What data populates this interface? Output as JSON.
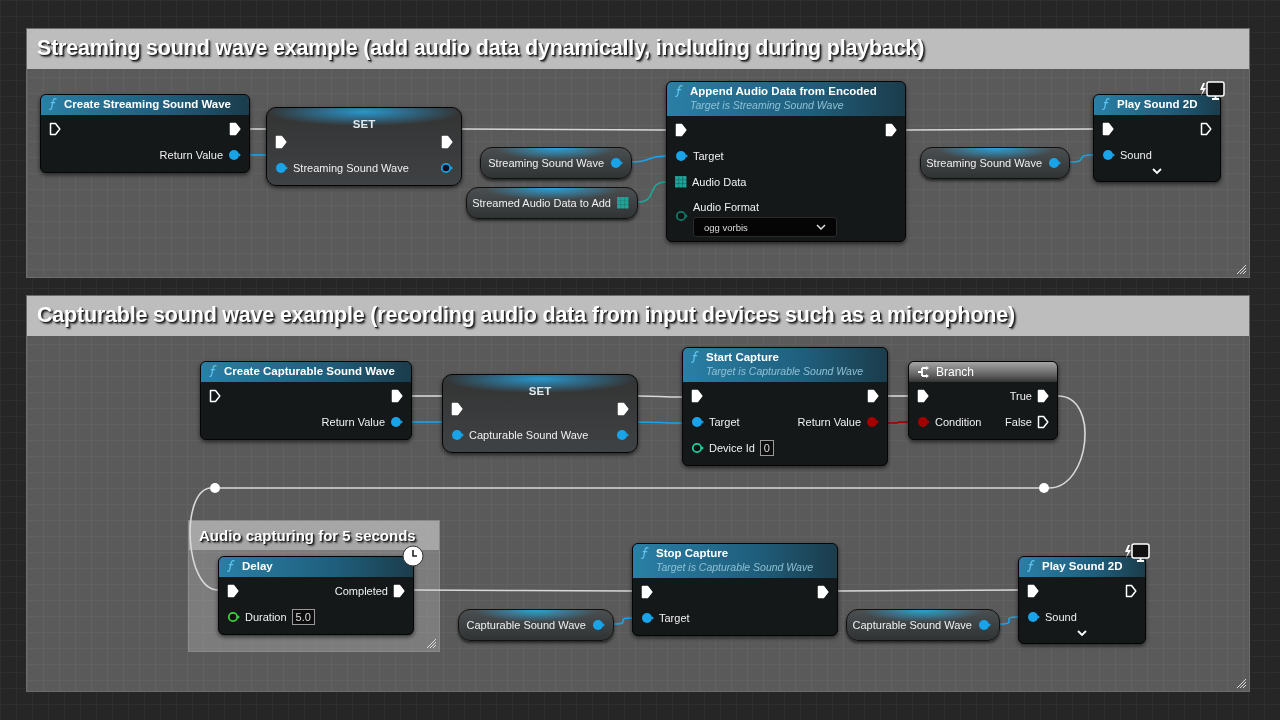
{
  "sections": [
    {
      "title": "Streaming sound wave example (add audio data dynamically, including during playback)",
      "nodes": [
        {
          "kind": "function",
          "title": "Create Streaming Sound Wave",
          "inputs": [
            {
              "kind": "exec",
              "connected": false
            }
          ],
          "outputs": [
            {
              "kind": "exec",
              "connected": true
            },
            {
              "kind": "object",
              "label": "Return Value",
              "connected": true
            }
          ]
        },
        {
          "kind": "set",
          "title": "SET",
          "inputs": [
            {
              "kind": "exec",
              "connected": true
            },
            {
              "kind": "object",
              "label": "Streaming Sound Wave",
              "connected": true
            }
          ],
          "outputs": [
            {
              "kind": "exec",
              "connected": true
            },
            {
              "kind": "object",
              "connected": false
            }
          ]
        },
        {
          "kind": "variable",
          "outputs": [
            {
              "kind": "object",
              "label": "Streaming Sound Wave",
              "connected": true
            }
          ]
        },
        {
          "kind": "variable",
          "outputs": [
            {
              "kind": "array",
              "label": "Streamed Audio Data to Add",
              "connected": true
            }
          ]
        },
        {
          "kind": "function",
          "title": "Append Audio Data from Encoded",
          "subtitle": "Target is Streaming Sound Wave",
          "inputs": [
            {
              "kind": "exec",
              "connected": true
            },
            {
              "kind": "object",
              "label": "Target",
              "connected": true
            },
            {
              "kind": "array",
              "label": "Audio Data",
              "connected": true
            },
            {
              "kind": "enum",
              "label": "Audio Format",
              "value": "ogg vorbis",
              "connected": false
            }
          ],
          "outputs": [
            {
              "kind": "exec",
              "connected": true
            }
          ]
        },
        {
          "kind": "variable",
          "outputs": [
            {
              "kind": "object",
              "label": "Streaming Sound Wave",
              "connected": true
            }
          ]
        },
        {
          "kind": "function",
          "title": "Play Sound 2D",
          "cosmetic": true,
          "advanced": true,
          "inputs": [
            {
              "kind": "exec",
              "connected": true
            },
            {
              "kind": "object",
              "label": "Sound",
              "connected": true
            }
          ],
          "outputs": [
            {
              "kind": "exec",
              "connected": false
            }
          ]
        }
      ]
    },
    {
      "title": "Capturable sound wave example (recording audio data from input devices such as a microphone)",
      "nodes": [
        {
          "kind": "function",
          "title": "Create Capturable Sound Wave",
          "inputs": [
            {
              "kind": "exec",
              "connected": false
            }
          ],
          "outputs": [
            {
              "kind": "exec",
              "connected": true
            },
            {
              "kind": "object",
              "label": "Return Value",
              "connected": true
            }
          ]
        },
        {
          "kind": "set",
          "title": "SET",
          "inputs": [
            {
              "kind": "exec",
              "connected": true
            },
            {
              "kind": "object",
              "label": "Capturable Sound Wave",
              "connected": true
            }
          ],
          "outputs": [
            {
              "kind": "exec",
              "connected": true
            },
            {
              "kind": "object",
              "connected": true
            }
          ]
        },
        {
          "kind": "function",
          "title": "Start Capture",
          "subtitle": "Target is Capturable Sound Wave",
          "inputs": [
            {
              "kind": "exec",
              "connected": true
            },
            {
              "kind": "object",
              "label": "Target",
              "connected": true
            },
            {
              "kind": "int",
              "label": "Device Id",
              "value": "0",
              "connected": false
            }
          ],
          "outputs": [
            {
              "kind": "exec",
              "connected": true
            },
            {
              "kind": "bool",
              "label": "Return Value",
              "connected": true
            }
          ]
        },
        {
          "kind": "branch",
          "title": "Branch",
          "inputs": [
            {
              "kind": "exec",
              "connected": true
            },
            {
              "kind": "bool",
              "label": "Condition",
              "connected": true
            }
          ],
          "outputs": [
            {
              "kind": "exec",
              "label": "True",
              "connected": true
            },
            {
              "kind": "exec",
              "label": "False",
              "connected": false
            }
          ]
        },
        {
          "kind": "comment",
          "title": "Audio capturing for 5 seconds"
        },
        {
          "kind": "function",
          "title": "Delay",
          "latent": true,
          "inputs": [
            {
              "kind": "exec",
              "connected": true
            },
            {
              "kind": "float",
              "label": "Duration",
              "value": "5.0",
              "connected": false
            }
          ],
          "outputs": [
            {
              "kind": "exec",
              "label": "Completed",
              "connected": true
            }
          ]
        },
        {
          "kind": "variable",
          "outputs": [
            {
              "kind": "object",
              "label": "Capturable Sound Wave",
              "connected": true
            }
          ]
        },
        {
          "kind": "function",
          "title": "Stop Capture",
          "subtitle": "Target is Capturable Sound Wave",
          "inputs": [
            {
              "kind": "exec",
              "connected": true
            },
            {
              "kind": "object",
              "label": "Target",
              "connected": true
            }
          ],
          "outputs": [
            {
              "kind": "exec",
              "connected": true
            }
          ]
        },
        {
          "kind": "variable",
          "outputs": [
            {
              "kind": "object",
              "label": "Capturable Sound Wave",
              "connected": true
            }
          ]
        },
        {
          "kind": "function",
          "title": "Play Sound 2D",
          "cosmetic": true,
          "advanced": true,
          "inputs": [
            {
              "kind": "exec",
              "connected": true
            },
            {
              "kind": "object",
              "label": "Sound",
              "connected": true
            }
          ],
          "outputs": [
            {
              "kind": "exec",
              "connected": false
            }
          ]
        }
      ]
    }
  ]
}
